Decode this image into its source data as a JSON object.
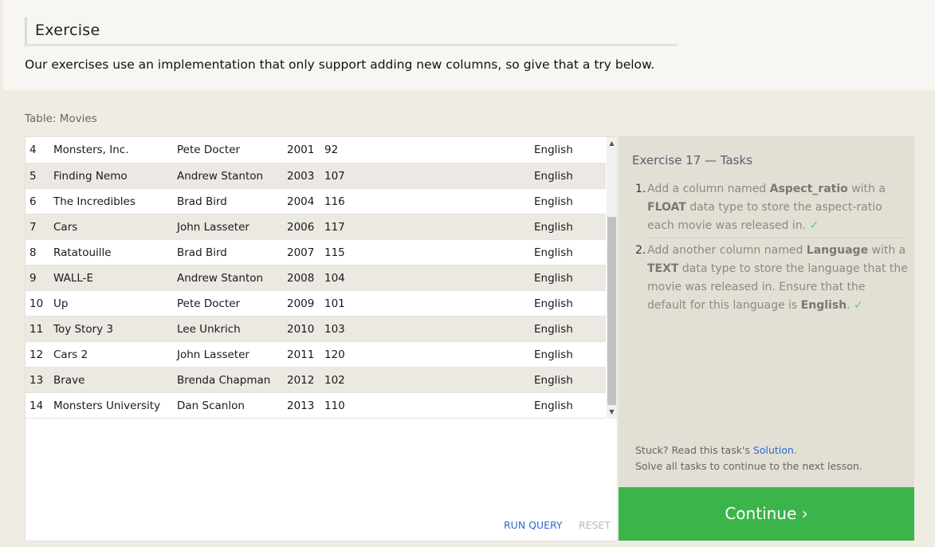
{
  "header": {
    "title": "Exercise",
    "intro": "Our exercises use an implementation that only support adding new columns, so give that a try below."
  },
  "table": {
    "label": "Table: Movies",
    "rows": [
      [
        "4",
        "Monsters, Inc.",
        "Pete Docter",
        "2001",
        "92",
        "English"
      ],
      [
        "5",
        "Finding Nemo",
        "Andrew Stanton",
        "2003",
        "107",
        "English"
      ],
      [
        "6",
        "The Incredibles",
        "Brad Bird",
        "2004",
        "116",
        "English"
      ],
      [
        "7",
        "Cars",
        "John Lasseter",
        "2006",
        "117",
        "English"
      ],
      [
        "8",
        "Ratatouille",
        "Brad Bird",
        "2007",
        "115",
        "English"
      ],
      [
        "9",
        "WALL-E",
        "Andrew Stanton",
        "2008",
        "104",
        "English"
      ],
      [
        "10",
        "Up",
        "Pete Docter",
        "2009",
        "101",
        "English"
      ],
      [
        "11",
        "Toy Story 3",
        "Lee Unkrich",
        "2010",
        "103",
        "English"
      ],
      [
        "12",
        "Cars 2",
        "John Lasseter",
        "2011",
        "120",
        "English"
      ],
      [
        "13",
        "Brave",
        "Brenda Chapman",
        "2012",
        "102",
        "English"
      ],
      [
        "14",
        "Monsters University",
        "Dan Scanlon",
        "2013",
        "110",
        "English"
      ]
    ],
    "run_query_label": "RUN QUERY",
    "reset_label": "RESET"
  },
  "tasks": {
    "title": "Exercise 17 — Tasks",
    "task1": {
      "num": "1.",
      "pre": "Add a column named ",
      "col": "Aspect_ratio",
      "mid": " with a ",
      "type": "FLOAT",
      "post": " data type to store the aspect-ratio each movie was released in.",
      "check": "✓"
    },
    "task2": {
      "num": "2.",
      "pre": "Add another column named ",
      "col": "Language",
      "mid": " with a ",
      "type": "TEXT",
      "post": " data type to store the language that the movie was released in. Ensure that the default for this language is ",
      "default": "English",
      "end": ".",
      "check": "✓"
    },
    "stuck_pre": "Stuck? Read this task's ",
    "solution_label": "Solution",
    "stuck_post": ".",
    "solve_all": "Solve all tasks to continue to the next lesson."
  },
  "continue_label": "Continue ›",
  "colors": {
    "accent_green": "#3bb54a",
    "link_blue": "#2a6bcc"
  }
}
